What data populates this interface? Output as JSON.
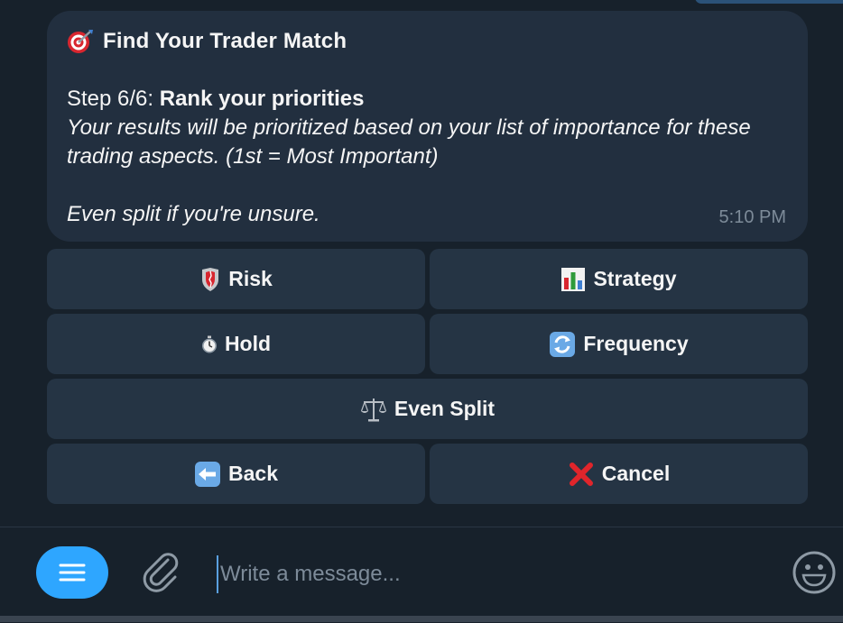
{
  "message": {
    "title_icon": "direct-hit-icon",
    "title": "Find Your Trader Match",
    "step_prefix": "Step 6/6: ",
    "step_title": "Rank your priorities",
    "description": "Your results will be prioritized based on your list of importance for these trading aspects. (1st = Most Important)",
    "hint": "Even split if you're unsure.",
    "time": "5:10 PM"
  },
  "keyboard": {
    "risk": "Risk",
    "strategy": "Strategy",
    "hold": "Hold",
    "frequency": "Frequency",
    "even_split": "Even Split",
    "back": "Back",
    "cancel": "Cancel"
  },
  "composer": {
    "placeholder": "Write a message..."
  },
  "colors": {
    "background": "#17212b",
    "bubble": "#222f3f",
    "button": "#253444",
    "accent": "#2ea6ff",
    "muted_text": "#7d8b99"
  }
}
